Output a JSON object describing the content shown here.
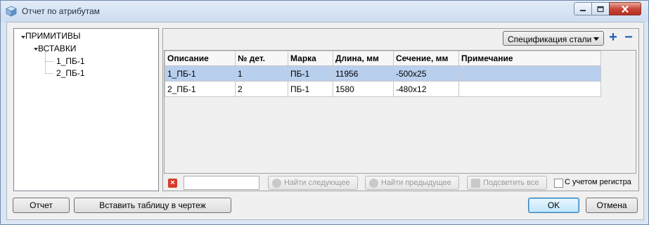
{
  "window": {
    "title": "Отчет по атрибутам",
    "controls": [
      "minimize-icon",
      "maximize-icon",
      "close-icon"
    ]
  },
  "tree": {
    "root": "ПРИМИТИВЫ",
    "child": "ВСТАВКИ",
    "leaves": [
      "1_ПБ-1",
      "2_ПБ-1"
    ]
  },
  "spec": {
    "selected": "Спецификация стали",
    "add": "+",
    "remove": "−"
  },
  "table": {
    "columns": [
      "Описание",
      "№ дет.",
      "Марка",
      "Длина, мм",
      "Сечение, мм",
      "Примечание"
    ],
    "rows": [
      [
        "1_ПБ-1",
        "1",
        "ПБ-1",
        "11956",
        "-500x25",
        ""
      ],
      [
        "2_ПБ-1",
        "2",
        "ПБ-1",
        "1580",
        "-480x12",
        ""
      ]
    ],
    "selected_row": 0
  },
  "search": {
    "clear_icon": "×",
    "value": "",
    "find_next": "Найти следующее",
    "find_prev": "Найти предыдущее",
    "highlight_all": "Подсветить все",
    "match_case": "С учетом регистра",
    "match_case_checked": false
  },
  "buttons": {
    "report": "Отчет",
    "insert_table": "Вставить таблицу в чертеж",
    "ok": "OK",
    "cancel": "Отмена"
  }
}
